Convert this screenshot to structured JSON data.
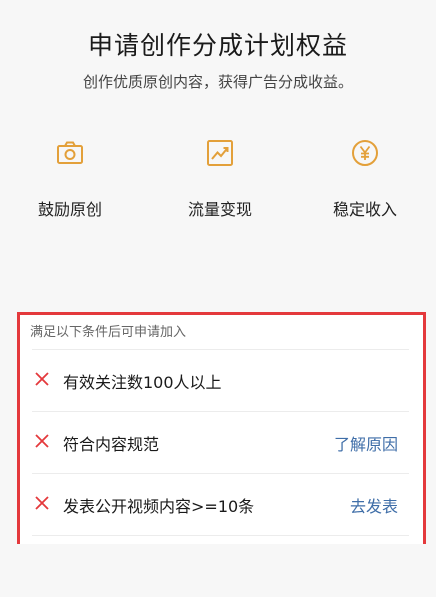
{
  "header": {
    "title": "申请创作分成计划权益",
    "subtitle": "创作优质原创内容，获得广告分成收益。"
  },
  "features": [
    {
      "icon": "camera-icon",
      "label": "鼓励原创"
    },
    {
      "icon": "trend-chart-icon",
      "label": "流量变现"
    },
    {
      "icon": "yen-coin-icon",
      "label": "稳定收入"
    }
  ],
  "conditions": {
    "heading": "满足以下条件后可申请加入",
    "items": [
      {
        "text": "有效关注数100人以上",
        "action": ""
      },
      {
        "text": "符合内容规范",
        "action": "了解原因"
      },
      {
        "text": "发表公开视频内容>=10条",
        "action": "去发表"
      }
    ]
  },
  "colors": {
    "accent": "#e4393c",
    "link": "#3f6ea8",
    "icon": "#e3a03a"
  }
}
